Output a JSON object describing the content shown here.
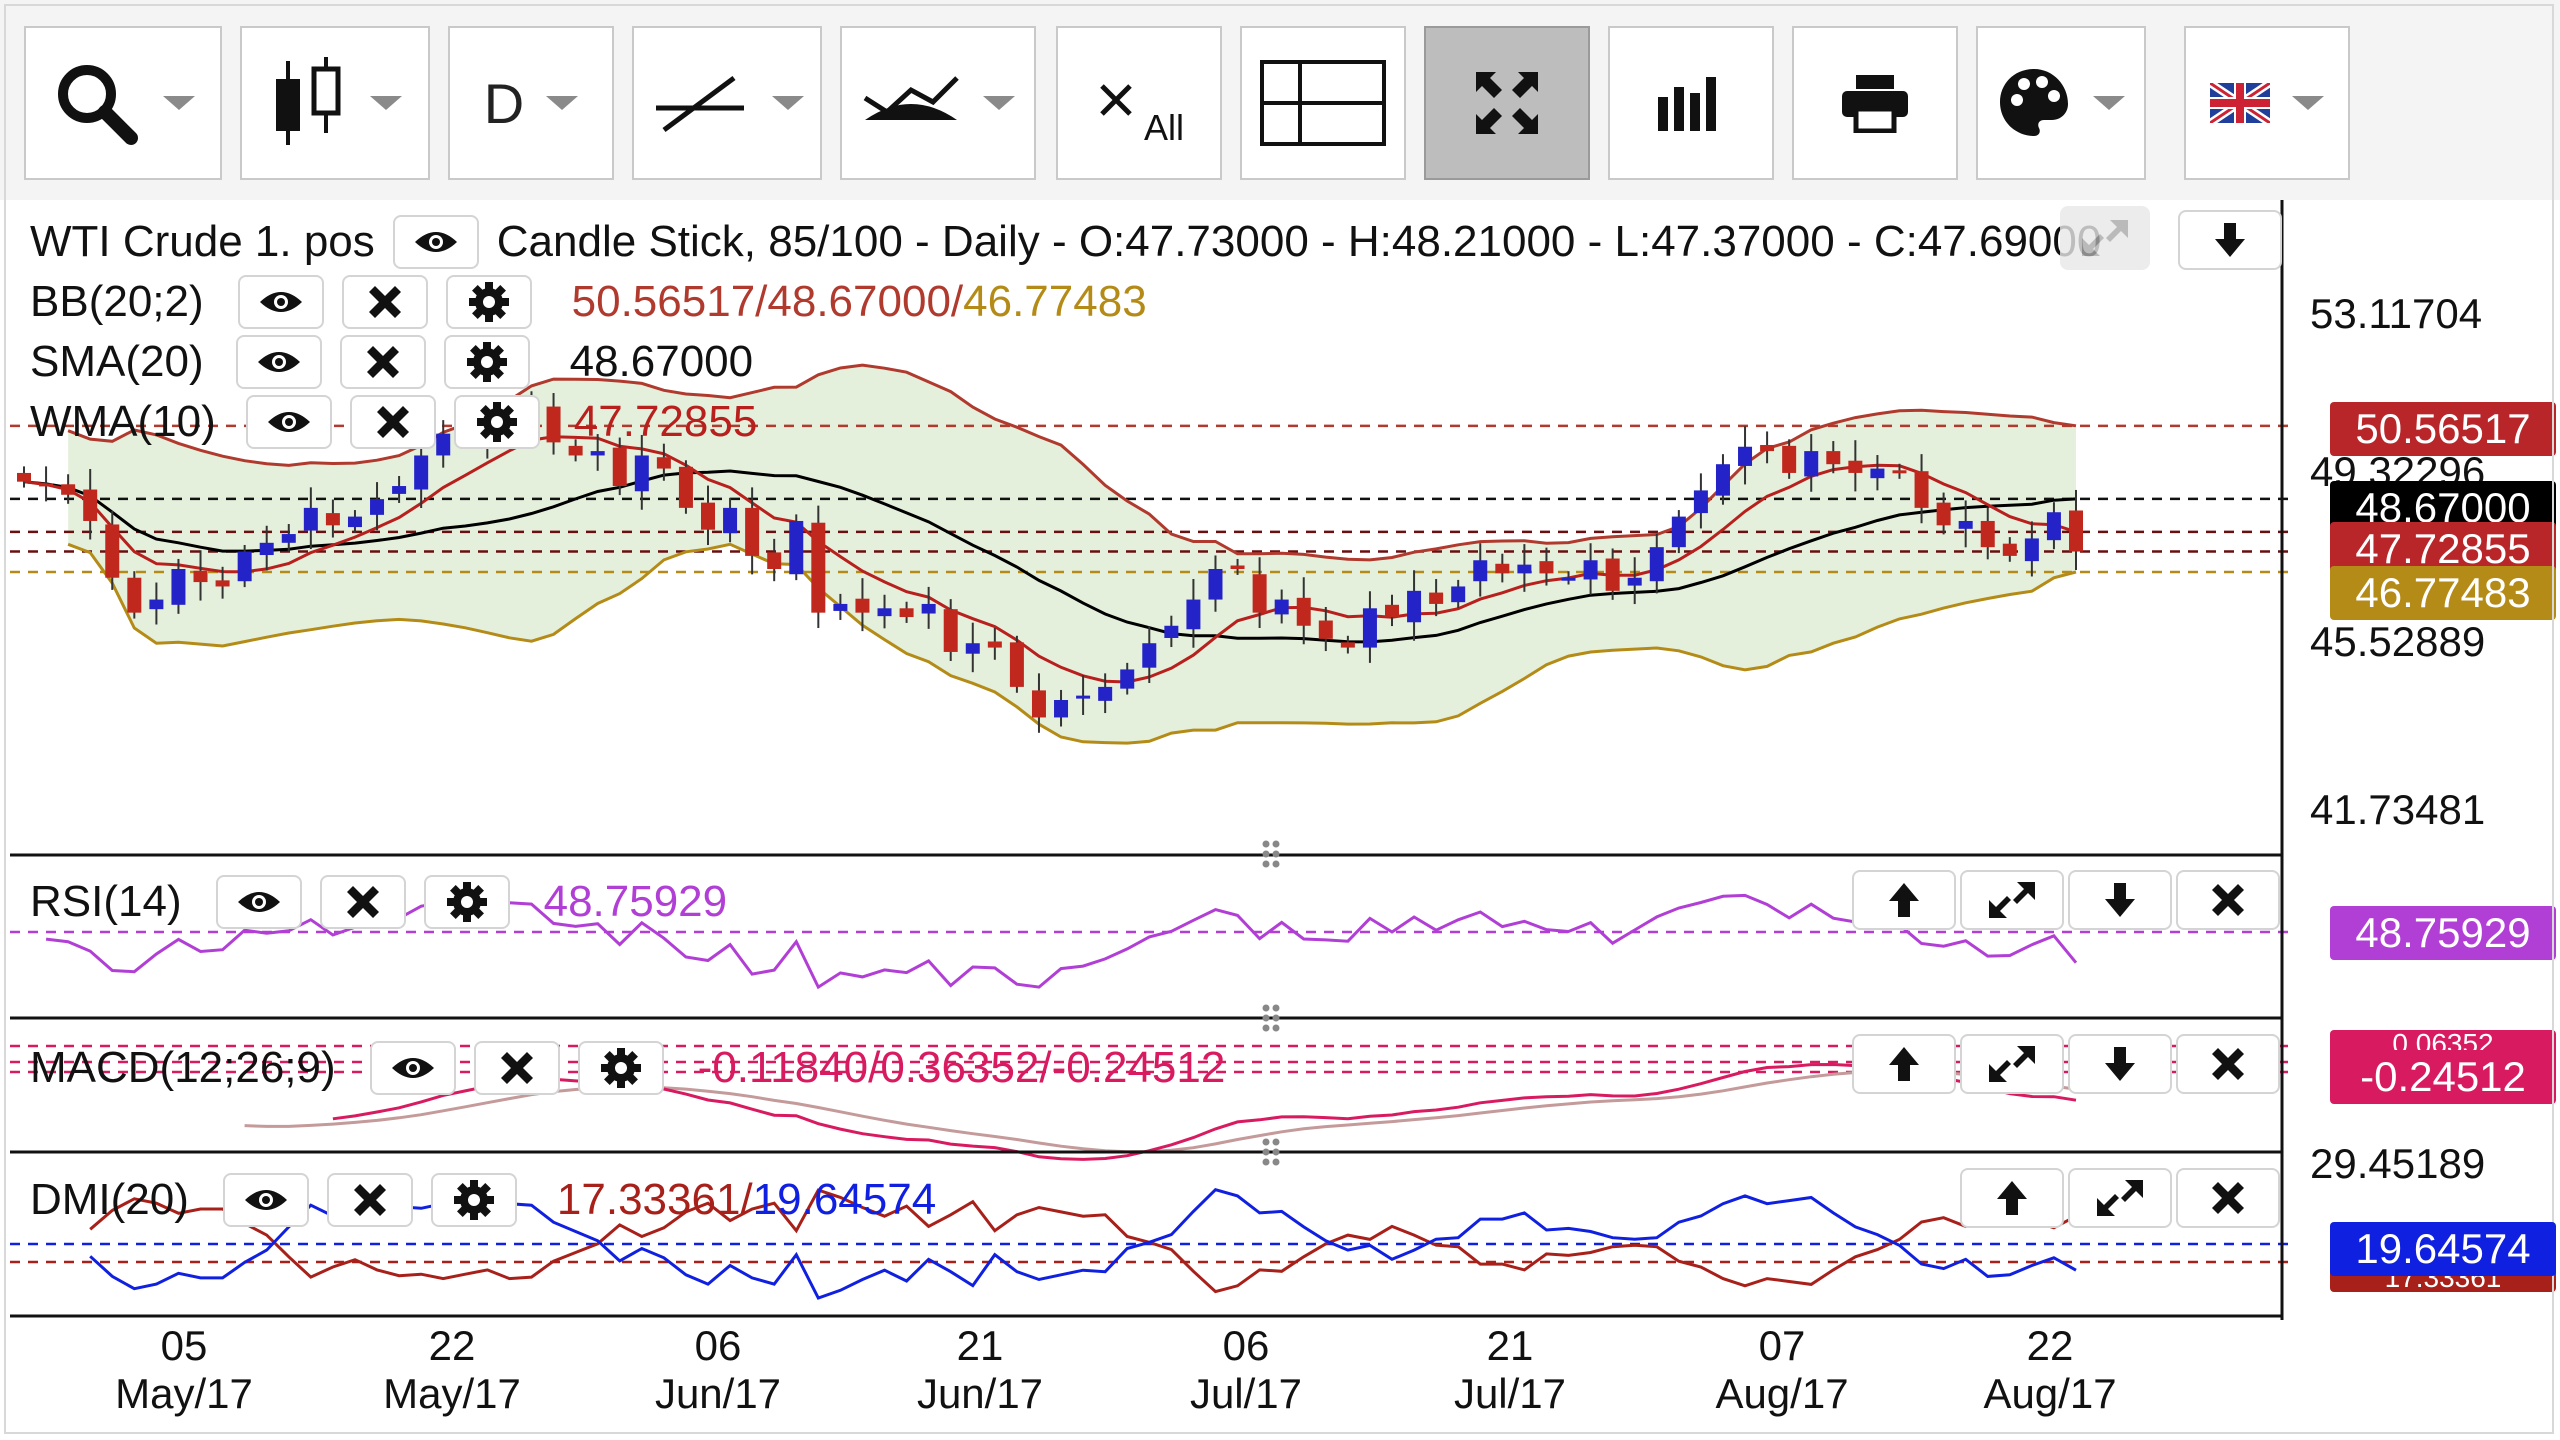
{
  "toolbar": {
    "buttons": [
      {
        "name": "search-button",
        "icon": "search-icon"
      },
      {
        "name": "chart-type-button",
        "icon": "candlestick-icon"
      },
      {
        "name": "period-button",
        "label": "D"
      },
      {
        "name": "draw-line-button",
        "icon": "trend-line-icon"
      },
      {
        "name": "indicators-button",
        "icon": "indicator-icon"
      },
      {
        "name": "clear-all-button",
        "label": "All",
        "icon": "close-all-icon"
      },
      {
        "name": "crosshair-button",
        "icon": "crosshair-icon"
      },
      {
        "name": "fullscreen-button",
        "icon": "fullscreen-icon"
      },
      {
        "name": "volume-button",
        "icon": "bar-chart-icon"
      },
      {
        "name": "print-button",
        "icon": "printer-icon"
      },
      {
        "name": "theme-button",
        "icon": "palette-icon"
      },
      {
        "name": "language-button",
        "icon": "uk-flag-icon"
      }
    ]
  },
  "main": {
    "instrument": "WTI Crude 1. pos",
    "info": "Candle Stick, 85/100 - Daily - O:47.73000 - H:48.21000 - L:47.37000 - C:47.69000",
    "indicators": [
      {
        "label": "BB(20;2)",
        "value_parts": [
          "50.56517/",
          "48.67000/",
          "46.77483"
        ]
      },
      {
        "label": "SMA(20)",
        "value": "48.67000"
      },
      {
        "label": "WMA(10)",
        "value": "47.72855"
      }
    ],
    "axis": [
      "53.11704",
      "49.32296",
      "45.52889",
      "41.73481"
    ],
    "tags": {
      "bb_upper": "50.56517",
      "sma": "48.67000",
      "wma": "47.72855",
      "bb_lower": "46.77483"
    }
  },
  "rsi": {
    "label": "RSI(14)",
    "value": "48.75929",
    "tag": "48.75929"
  },
  "macd": {
    "label": "MACD(12;26;9)",
    "value": "-0.11840/0.36352/-0.24512",
    "tag": "-0.24512",
    "tag2": "0.06352"
  },
  "dmi": {
    "label": "DMI(20)",
    "value_parts": [
      "17.33361/",
      "19.64574"
    ],
    "axis": "29.45189",
    "tag_plus": "19.64574",
    "tag_minus": "17.33361"
  },
  "dates": [
    {
      "day": "05",
      "month": "May/17"
    },
    {
      "day": "22",
      "month": "May/17"
    },
    {
      "day": "06",
      "month": "Jun/17"
    },
    {
      "day": "21",
      "month": "Jun/17"
    },
    {
      "day": "06",
      "month": "Jul/17"
    },
    {
      "day": "21",
      "month": "Jul/17"
    },
    {
      "day": "07",
      "month": "Aug/17"
    },
    {
      "day": "22",
      "month": "Aug/17"
    }
  ],
  "colors": {
    "bull": "#2323c8",
    "bear": "#c0281e",
    "bb_fill": "#e5f0dc",
    "bb_upper": "#b03a2e",
    "bb_lower": "#b58b18",
    "sma": "#000000",
    "wma": "#b8201e",
    "rsi": "#b13fd6",
    "macd_line": "#d81b60",
    "macd_signal": "#c49a9a",
    "dmi_plus": "#1020e0",
    "dmi_minus": "#a8201a"
  },
  "chart_data": [
    {
      "type": "candlestick",
      "title": "WTI Crude 1. pos",
      "y_axis_ticks": [
        53.11704,
        49.32296,
        45.52889,
        41.73481
      ],
      "x_ticks": [
        "05 May/17",
        "22 May/17",
        "06 Jun/17",
        "21 Jun/17",
        "06 Jul/17",
        "21 Jul/17",
        "07 Aug/17",
        "22 Aug/17"
      ],
      "last_values": {
        "open": 47.73,
        "high": 48.21,
        "low": 47.37,
        "close": 47.69,
        "bb_upper": 50.56517,
        "bb_mid": 48.67,
        "bb_lower": 46.77483,
        "sma20": 48.67,
        "wma10": 47.72855
      },
      "close_series": [
        49.3,
        49.2,
        49.0,
        48.4,
        47.1,
        46.3,
        46.6,
        47.3,
        47.0,
        46.9,
        47.7,
        47.9,
        48.1,
        48.7,
        48.3,
        48.5,
        48.9,
        49.2,
        49.9,
        50.4,
        50.3,
        50.6,
        50.8,
        50.9,
        50.2,
        49.9,
        50.0,
        49.2,
        49.9,
        49.6,
        48.7,
        48.2,
        48.7,
        47.6,
        47.3,
        48.4,
        46.3,
        46.5,
        46.3,
        46.4,
        46.2,
        46.5,
        45.4,
        45.6,
        45.5,
        44.6,
        43.9,
        44.3,
        44.4,
        44.6,
        45.0,
        45.6,
        46.0,
        46.6,
        47.3,
        47.3,
        46.3,
        46.6,
        46.0,
        45.7,
        45.5,
        46.4,
        46.2,
        46.8,
        46.5,
        46.9,
        47.5,
        47.2,
        47.4,
        47.2,
        47.1,
        47.5,
        46.8,
        47.1,
        47.8,
        48.5,
        49.1,
        49.7,
        50.1,
        50.0,
        49.5,
        50.0,
        49.7,
        49.5,
        49.6,
        49.5,
        48.7,
        48.3,
        48.4,
        47.8,
        47.6,
        48.0,
        48.6,
        47.7
      ]
    },
    {
      "type": "line",
      "title": "RSI(14)",
      "last_value": 48.75929
    },
    {
      "type": "line",
      "title": "MACD(12;26;9)",
      "last_values": {
        "macd": -0.1184,
        "signal": 0.36352,
        "histogram": -0.24512
      }
    },
    {
      "type": "line",
      "title": "DMI(20)",
      "last_values": {
        "minus_di": 17.33361,
        "plus_di": 19.64574
      },
      "y_axis_ticks": [
        29.45189
      ]
    }
  ]
}
